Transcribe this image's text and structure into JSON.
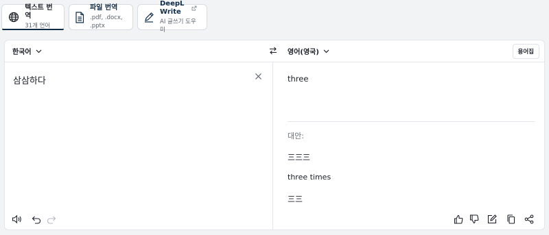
{
  "tabs": [
    {
      "title": "텍스트 번역",
      "sub": "31개 언어",
      "icon": "globe-icon"
    },
    {
      "title": "파일 번역",
      "sub": ".pdf, .docx, .pptx",
      "icon": "document-icon"
    },
    {
      "title": "DeepL Write",
      "sub": "AI 글쓰기 도우미",
      "icon": "pen-icon"
    }
  ],
  "languages": {
    "source": "한국어",
    "target": "영어(영국)"
  },
  "glossary_label": "용어집",
  "source_text": "삼삼하다",
  "translation": "three",
  "alternatives": {
    "heading": "대안:",
    "items": [
      "三三三",
      "three times",
      "三三"
    ]
  },
  "colors": {
    "accent": "#0f2b46",
    "background": "#f1f3f5",
    "border": "#e3e6ea"
  }
}
